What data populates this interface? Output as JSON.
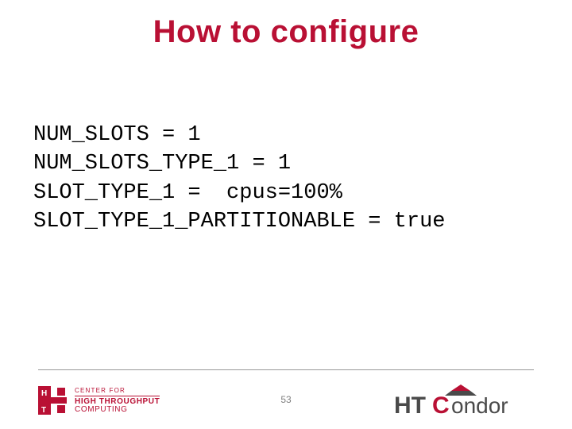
{
  "title": "How to configure",
  "config_lines": [
    "NUM_SLOTS = 1",
    "NUM_SLOTS_TYPE_1 = 1",
    "SLOT_TYPE_1 =  cpus=100%",
    "SLOT_TYPE_1_PARTITIONABLE = true"
  ],
  "page_number": "53",
  "logos": {
    "chtc": {
      "line1": "CENTER FOR",
      "line2": "HIGH THROUGHPUT",
      "line3": "COMPUTING"
    },
    "condor": {
      "ht": "HT",
      "c": "C",
      "ondor": "ondor"
    }
  },
  "colors": {
    "accent": "#b91034"
  }
}
